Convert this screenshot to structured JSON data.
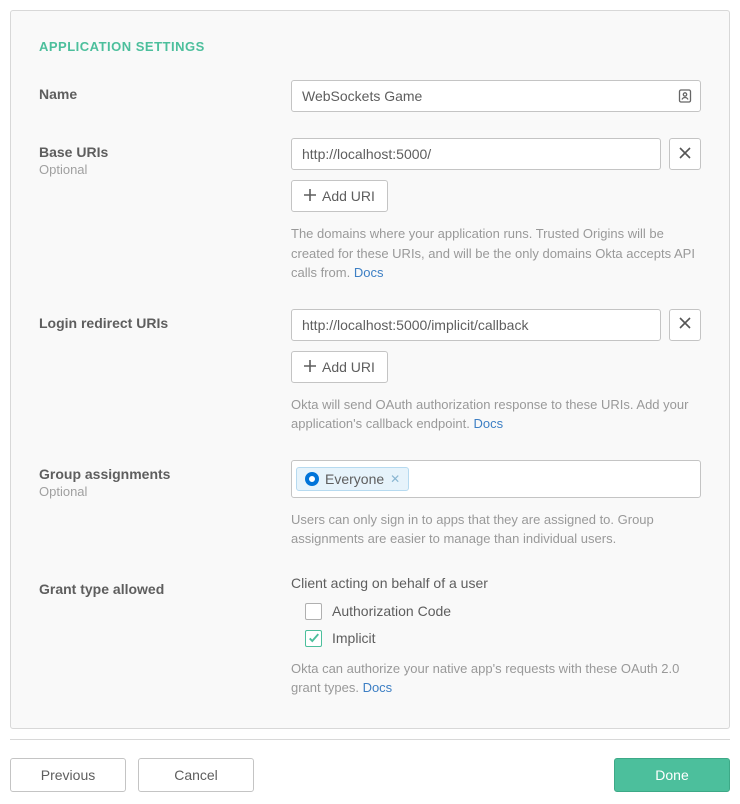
{
  "section_title": "APPLICATION SETTINGS",
  "name": {
    "label": "Name",
    "value": "WebSockets Game"
  },
  "base_uris": {
    "label": "Base URIs",
    "sublabel": "Optional",
    "value": "http://localhost:5000/",
    "add_label": "Add URI",
    "helper": "The domains where your application runs. Trusted Origins will be created for these URIs, and will be the only domains Okta accepts API calls from.",
    "docs": "Docs"
  },
  "login_redirect": {
    "label": "Login redirect URIs",
    "value": "http://localhost:5000/implicit/callback",
    "add_label": "Add URI",
    "helper": "Okta will send OAuth authorization response to these URIs. Add your application's callback endpoint.",
    "docs": "Docs"
  },
  "group_assignments": {
    "label": "Group assignments",
    "sublabel": "Optional",
    "tag": "Everyone",
    "helper": "Users can only sign in to apps that they are assigned to. Group assignments are easier to manage than individual users."
  },
  "grant_type": {
    "label": "Grant type allowed",
    "sub_heading": "Client acting on behalf of a user",
    "options": {
      "authorization_code": {
        "label": "Authorization Code",
        "checked": false
      },
      "implicit": {
        "label": "Implicit",
        "checked": true
      }
    },
    "helper": "Okta can authorize your native app's requests with these OAuth 2.0 grant types.",
    "docs": "Docs"
  },
  "footer": {
    "previous": "Previous",
    "cancel": "Cancel",
    "done": "Done"
  }
}
